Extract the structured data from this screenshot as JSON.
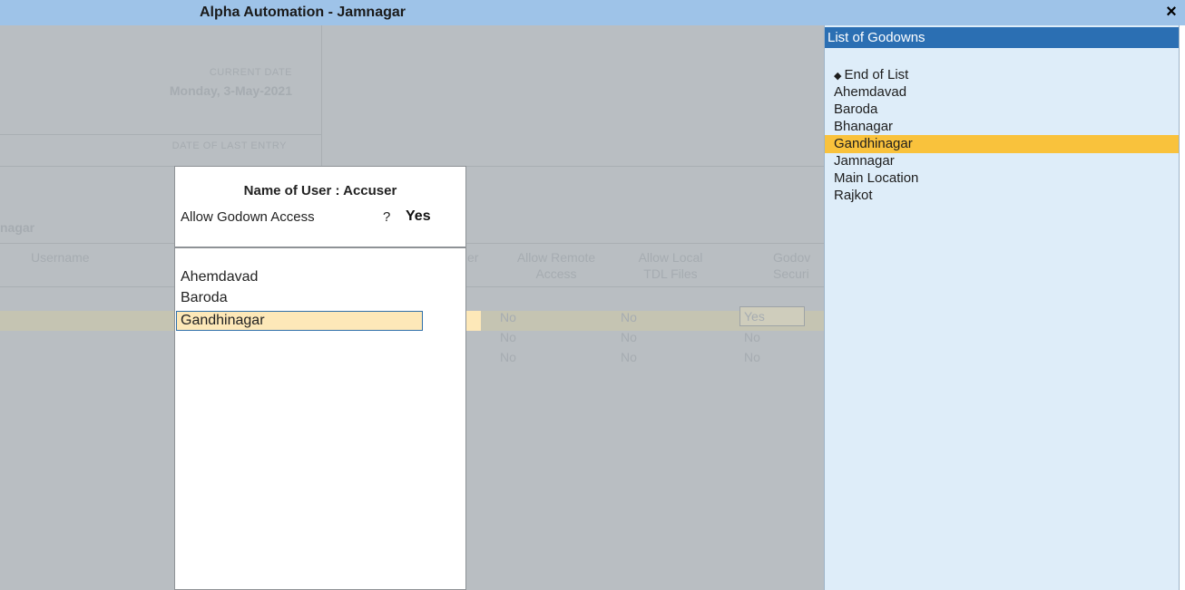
{
  "window": {
    "title": "Alpha Automation - Jamnagar",
    "close_label": "×"
  },
  "background": {
    "current_date_label": "CURRENT DATE",
    "current_date_value": "Monday, 3-May-2021",
    "last_entry_label": "DATE OF LAST ENTRY",
    "company_partial": "nagar",
    "columns": {
      "username": "Username",
      "col_partial": "er",
      "allow_remote": "Allow Remote\nAccess",
      "allow_local_tdl": "Allow Local\nTDL Files",
      "godown_security": "Godov\nSecuri"
    },
    "rows": [
      {
        "remote": "No",
        "tdl": "No",
        "godown": "Yes"
      },
      {
        "remote": "No",
        "tdl": "No",
        "godown": "No"
      },
      {
        "remote": "No",
        "tdl": "No",
        "godown": "No"
      }
    ]
  },
  "popup": {
    "user_label": "Name of User : Accuser",
    "access_label": "Allow Godown Access",
    "access_question": "?",
    "access_value": "Yes",
    "godowns": [
      "Ahemdavad",
      "Baroda",
      "Gandhinagar"
    ]
  },
  "list": {
    "title": "List of Godowns",
    "end_marker": "◆",
    "items": [
      "End of List",
      "Ahemdavad",
      "Baroda",
      "Bhanagar",
      "Gandhinagar",
      "Jamnagar",
      "Main Location",
      "Rajkot"
    ],
    "highlighted": "Gandhinagar"
  }
}
